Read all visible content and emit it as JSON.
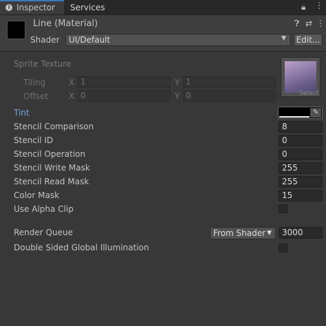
{
  "tabs": {
    "inspector": "Inspector",
    "services": "Services"
  },
  "material": {
    "title": "Line (Material)",
    "shader_label": "Shader",
    "shader_value": "UI/Default",
    "edit_label": "Edit..."
  },
  "sprite_texture": {
    "label": "Sprite Texture",
    "tiling_label": "Tiling",
    "offset_label": "Offset",
    "x_label": "X",
    "y_label": "Y",
    "tiling_x": "1",
    "tiling_y": "1",
    "offset_x": "0",
    "offset_y": "0",
    "select_label": "Select"
  },
  "properties": {
    "tint": "Tint",
    "stencil_comparison": {
      "label": "Stencil Comparison",
      "value": "8"
    },
    "stencil_id": {
      "label": "Stencil ID",
      "value": "0"
    },
    "stencil_operation": {
      "label": "Stencil Operation",
      "value": "0"
    },
    "stencil_write_mask": {
      "label": "Stencil Write Mask",
      "value": "255"
    },
    "stencil_read_mask": {
      "label": "Stencil Read Mask",
      "value": "255"
    },
    "color_mask": {
      "label": "Color Mask",
      "value": "15"
    },
    "use_alpha_clip": "Use Alpha Clip"
  },
  "render_queue": {
    "label": "Render Queue",
    "mode": "From Shader",
    "value": "3000"
  },
  "double_sided_gi": "Double Sided Global Illumination",
  "colors": {
    "tint_color": "#000000",
    "accent": "#3a79bb"
  }
}
